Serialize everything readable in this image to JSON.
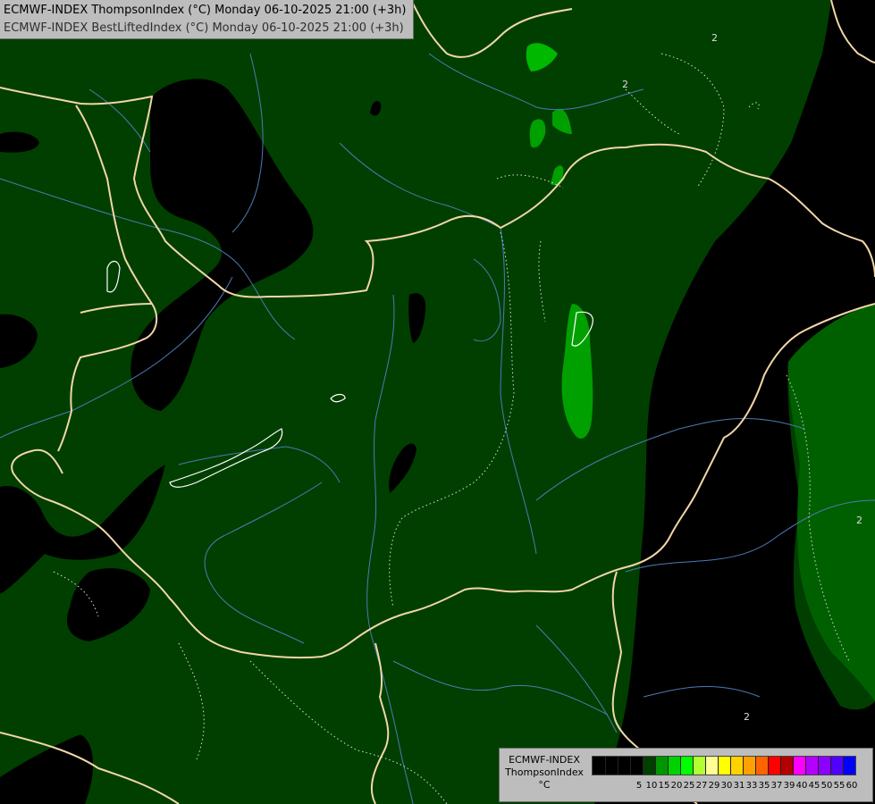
{
  "title": {
    "line1": "ECMWF-INDEX ThompsonIndex (°C) Monday 06-10-2025 21:00 (+3h)",
    "line2": "ECMWF-INDEX BestLiftedIndex (°C) Monday 06-10-2025 21:00 (+3h)"
  },
  "colors": {
    "field_low": "#000000",
    "field_main": "#003f00",
    "field_20": "#006400",
    "field_25": "#00a000",
    "field_27": "#00cc00",
    "borders": "#f2d6a8",
    "rivers": "#4f79b5",
    "contours": "#dddddd"
  },
  "map_labels": {
    "contour_a": "2",
    "contour_b": "2",
    "contour_c": "2",
    "contour_d": "2"
  },
  "legend": {
    "model": "ECMWF-INDEX",
    "parameter": "ThompsonIndex",
    "unit": "°C",
    "colors": [
      "#000000",
      "#000000",
      "#000000",
      "#000000",
      "#003f00",
      "#009600",
      "#00d200",
      "#00ff00",
      "#b4ff32",
      "#ffff96",
      "#ffff00",
      "#ffd200",
      "#ffa000",
      "#ff6400",
      "#ff0000",
      "#b40000",
      "#ff00ff",
      "#b400ff",
      "#8c00ff",
      "#5000ff",
      "#0000ff"
    ],
    "ticks": [
      "5",
      "10",
      "15",
      "20",
      "25",
      "27",
      "29",
      "30",
      "31",
      "33",
      "35",
      "37",
      "39",
      "40",
      "45",
      "50",
      "55",
      "60"
    ]
  }
}
